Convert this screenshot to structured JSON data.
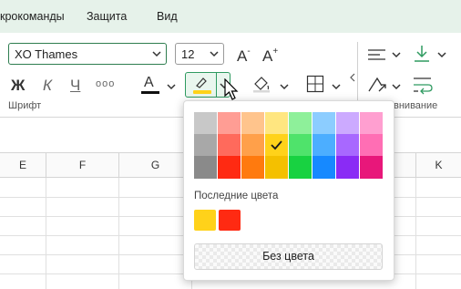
{
  "menu": [
    "крокоманды",
    "Защита",
    "Вид"
  ],
  "ribbon": {
    "font_name": "XO Thames",
    "font_size": "12",
    "bold": "Ж",
    "italic": "К",
    "underline": "Ч",
    "more": "ооо",
    "font_color_glyph": "A",
    "grow_font": "A",
    "shrink_font": "A",
    "group_font_label": "Шрифт",
    "group_align_label": "внивание",
    "font_color_hex": "#111111",
    "highlight_hex": "#ffd21a"
  },
  "columns": [
    "E",
    "F",
    "G",
    "K"
  ],
  "palette": {
    "columns": [
      [
        "#c8c8c8",
        "#a8a8a8",
        "#8a8a8a"
      ],
      [
        "#ff9d94",
        "#ff6a5c",
        "#ff2a12"
      ],
      [
        "#ffc48c",
        "#ffa04a",
        "#ff7a0e"
      ],
      [
        "#ffe680",
        "#ffd21a",
        "#f4c000"
      ],
      [
        "#8ef09a",
        "#4fe36b",
        "#18d241"
      ],
      [
        "#8ccdff",
        "#4caeff",
        "#1689ff"
      ],
      [
        "#ccaaff",
        "#a868ff",
        "#8a2bf5"
      ],
      [
        "#ff9fd0",
        "#ff6eb4",
        "#e8177a"
      ]
    ],
    "selected": "#ffd21a",
    "recent_label": "Последние цвета",
    "recent": [
      "#ffd21a",
      "#ff2a12"
    ],
    "no_color_label": "Без цвета"
  }
}
